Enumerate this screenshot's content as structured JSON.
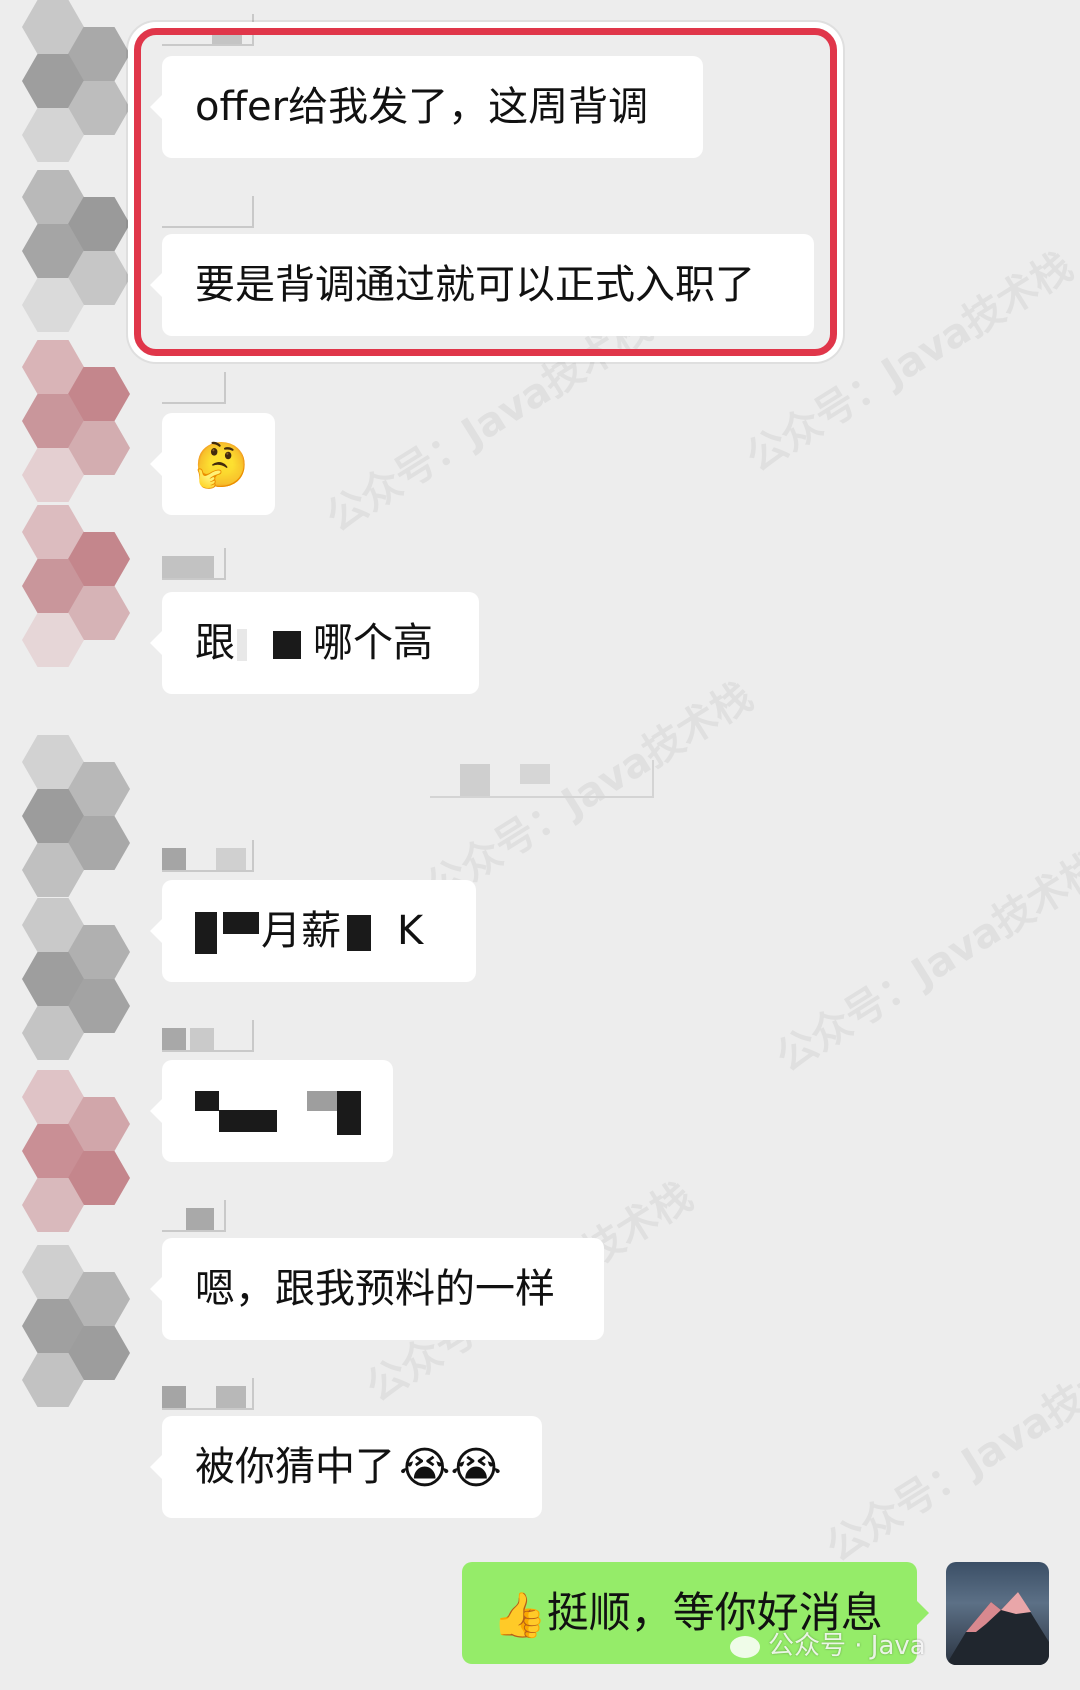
{
  "messages": [
    {
      "id": "m1",
      "text": "offer给我发了，这周背调"
    },
    {
      "id": "m2",
      "text": "要是背调通过就可以正式入职了"
    },
    {
      "id": "m3",
      "emoji": "🤔"
    },
    {
      "id": "m4",
      "prefix": "跟",
      "suffix": "哪个高"
    },
    {
      "id": "m5",
      "mid": "月薪",
      "suffix": "K"
    },
    {
      "id": "m6"
    },
    {
      "id": "m7",
      "text": "嗯，跟我预料的一样"
    },
    {
      "id": "m8",
      "text": "被你猜中了",
      "emoji": "😭😭"
    }
  ],
  "sent": {
    "emoji": "👍",
    "text": "挺顺，等你好消息"
  },
  "watermark": {
    "text": "公众号：Java技术栈",
    "footer": "公众号 · Java"
  },
  "colors": {
    "highlight": "#e0364a",
    "sent_bubble": "#95ec69",
    "background": "#ededed"
  }
}
